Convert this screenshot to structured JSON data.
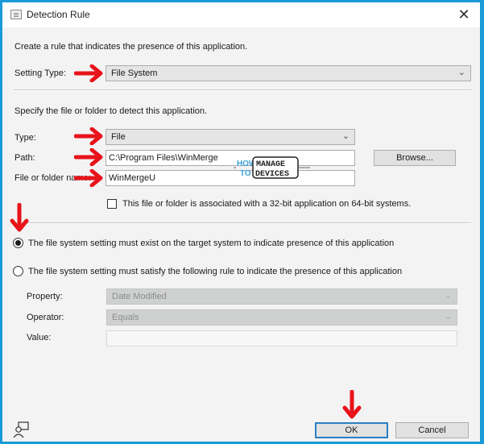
{
  "window": {
    "title": "Detection Rule",
    "close_symbol": "✕"
  },
  "intro_text": "Create a rule that indicates the presence of this application.",
  "setting_type": {
    "label": "Setting Type:",
    "value": "File System"
  },
  "file_section": {
    "intro": "Specify the file or folder to detect this application.",
    "type_label": "Type:",
    "type_value": "File",
    "path_label": "Path:",
    "path_value": "C:\\Program Files\\WinMerge",
    "browse_label": "Browse...",
    "name_label": "File or folder name:",
    "name_value": "WinMergeU",
    "checkbox_label": "This file or folder is associated with a 32-bit application on 64-bit systems.",
    "checkbox_checked": false
  },
  "rules": {
    "option_exist": "The file system setting must exist on the target system to indicate presence of this application",
    "option_rule": "The file system setting must satisfy the following rule to indicate the presence of this application",
    "selected": "exist",
    "property_label": "Property:",
    "property_value": "Date Modified",
    "operator_label": "Operator:",
    "operator_value": "Equals",
    "value_label": "Value:",
    "value_value": ""
  },
  "footer": {
    "ok_label": "OK",
    "cancel_label": "Cancel"
  },
  "watermark": {
    "how": "HOW",
    "to": "TO",
    "line1": "MANAGE",
    "line2": "DEVICES"
  },
  "colors": {
    "window_border": "#1a9ad6",
    "annotation_arrow": "#e8131b",
    "default_button_border": "#2b7fc5"
  }
}
